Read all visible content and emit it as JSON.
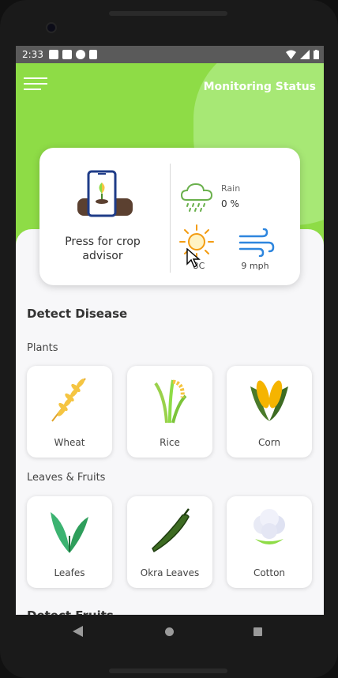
{
  "status_bar": {
    "time": "2:33",
    "icons": [
      "notification-square-icon",
      "notification-square-icon",
      "settings-icon",
      "sim-icon",
      "wifi-icon",
      "signal-icon",
      "battery-icon"
    ]
  },
  "header": {
    "title": "Monitoring Status",
    "menu_icon": "hamburger-menu-icon",
    "bg_color": "#8edc46"
  },
  "advisor": {
    "label": "Press for crop advisor",
    "icon": "phone-plant-icon"
  },
  "weather": {
    "rain_label": "Rain",
    "rain_value": "0 %",
    "temperature": "3C",
    "wind": "9 mph"
  },
  "detect_disease": {
    "title": "Detect Disease",
    "plants_title": "Plants",
    "plants": [
      {
        "label": "Wheat",
        "icon": "wheat-icon"
      },
      {
        "label": "Rice",
        "icon": "rice-icon"
      },
      {
        "label": "Corn",
        "icon": "corn-icon"
      }
    ],
    "leaves_title": "Leaves & Fruits",
    "leaves": [
      {
        "label": "Leafes",
        "icon": "banana-leaf-icon"
      },
      {
        "label": "Okra Leaves",
        "icon": "okra-icon"
      },
      {
        "label": "Cotton",
        "icon": "cotton-icon"
      }
    ]
  },
  "detect_fruits": {
    "title": "Detect Fruits"
  }
}
